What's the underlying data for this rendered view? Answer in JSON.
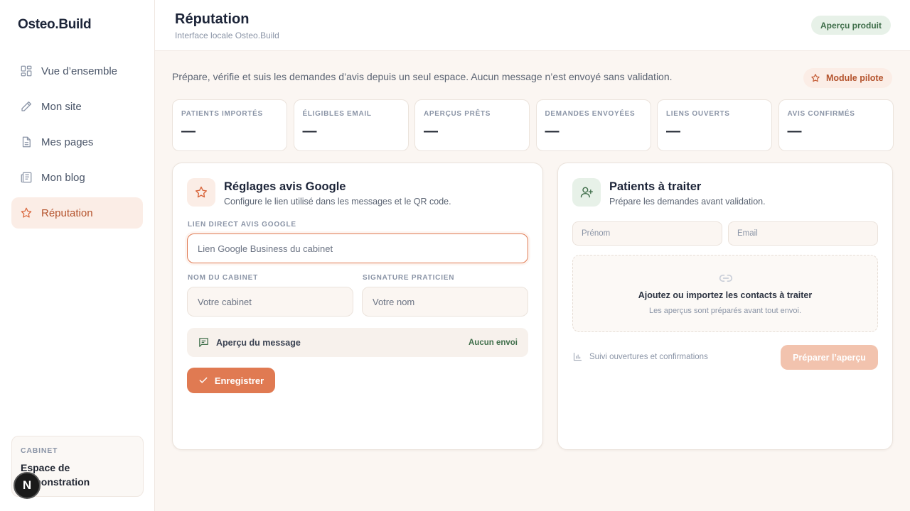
{
  "app": {
    "logo": "Osteo.Build"
  },
  "sidebar": {
    "items": [
      {
        "label": "Vue d’ensemble",
        "icon": "grid-icon"
      },
      {
        "label": "Mon site",
        "icon": "pencil-icon"
      },
      {
        "label": "Mes pages",
        "icon": "document-icon"
      },
      {
        "label": "Mon blog",
        "icon": "newspaper-icon"
      },
      {
        "label": "Réputation",
        "icon": "star-icon",
        "active": true
      }
    ],
    "cabinet": {
      "label": "CABINET",
      "name": "Espace de démonstration"
    },
    "badge": "N"
  },
  "header": {
    "title": "Réputation",
    "subtitle": "Interface locale Osteo.Build",
    "badge": "Aperçu produit"
  },
  "intro": {
    "text": "Prépare, vérifie et suis les demandes d’avis depuis un seul espace. Aucun message n’est envoyé sans validation.",
    "pill": "Module pilote"
  },
  "stats": [
    {
      "label": "PATIENTS IMPORTÉS",
      "value": "—"
    },
    {
      "label": "ÉLIGIBLES EMAIL",
      "value": "—"
    },
    {
      "label": "APERÇUS PRÊTS",
      "value": "—"
    },
    {
      "label": "DEMANDES ENVOYÉES",
      "value": "—"
    },
    {
      "label": "LIENS OUVERTS",
      "value": "—"
    },
    {
      "label": "AVIS CONFIRMÉS",
      "value": "—"
    }
  ],
  "google_settings": {
    "title": "Réglages avis Google",
    "subtitle": "Configure le lien utilisé dans les messages et le QR code.",
    "link_label": "LIEN DIRECT AVIS GOOGLE",
    "link_placeholder": "Lien Google Business du cabinet",
    "cabinet_label": "NOM DU CABINET",
    "cabinet_placeholder": "Votre cabinet",
    "signature_label": "SIGNATURE PRATICIEN",
    "signature_placeholder": "Votre nom",
    "preview_label": "Aperçu du message",
    "preview_status": "Aucun envoi",
    "save_label": "Enregistrer"
  },
  "patients": {
    "title": "Patients à traiter",
    "subtitle": "Prépare les demandes avant validation.",
    "firstname_placeholder": "Prénom",
    "email_placeholder": "Email",
    "empty_title": "Ajoutez ou importez les contacts à traiter",
    "empty_sub": "Les aperçus sont préparés avant tout envoi.",
    "tracking": "Suivi ouvertures et confirmations",
    "prepare_label": "Préparer l’aperçu"
  },
  "colors": {
    "accent": "#e07a52",
    "accent_soft": "#fbede6",
    "success": "#3f6e4a",
    "success_soft": "#e7f1e8"
  }
}
